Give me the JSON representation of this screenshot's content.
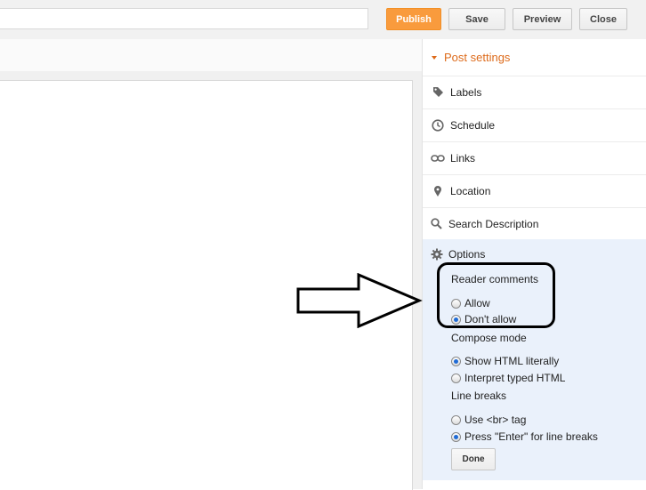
{
  "toolbar": {
    "publish": "Publish",
    "save": "Save",
    "preview": "Preview",
    "close": "Close"
  },
  "sidebar": {
    "post_settings": "Post settings",
    "sections": [
      "Labels",
      "Schedule",
      "Links",
      "Location",
      "Search Description"
    ],
    "options": {
      "title": "Options",
      "reader_comments": {
        "title": "Reader comments",
        "choices": [
          "Allow",
          "Don't allow"
        ],
        "selected": "Don't allow"
      },
      "compose_mode": {
        "title": "Compose mode",
        "choices": [
          "Show HTML literally",
          "Interpret typed HTML"
        ],
        "selected": "Show HTML literally"
      },
      "line_breaks": {
        "title": "Line breaks",
        "choices": [
          "Use <br> tag",
          "Press \"Enter\" for line breaks"
        ],
        "selected": "Press \"Enter\" for line breaks"
      },
      "done": "Done"
    }
  },
  "colors": {
    "accent": "#dd6a1a",
    "publish_bg": "#f99b3d",
    "options_bg": "#eaf1fb"
  }
}
